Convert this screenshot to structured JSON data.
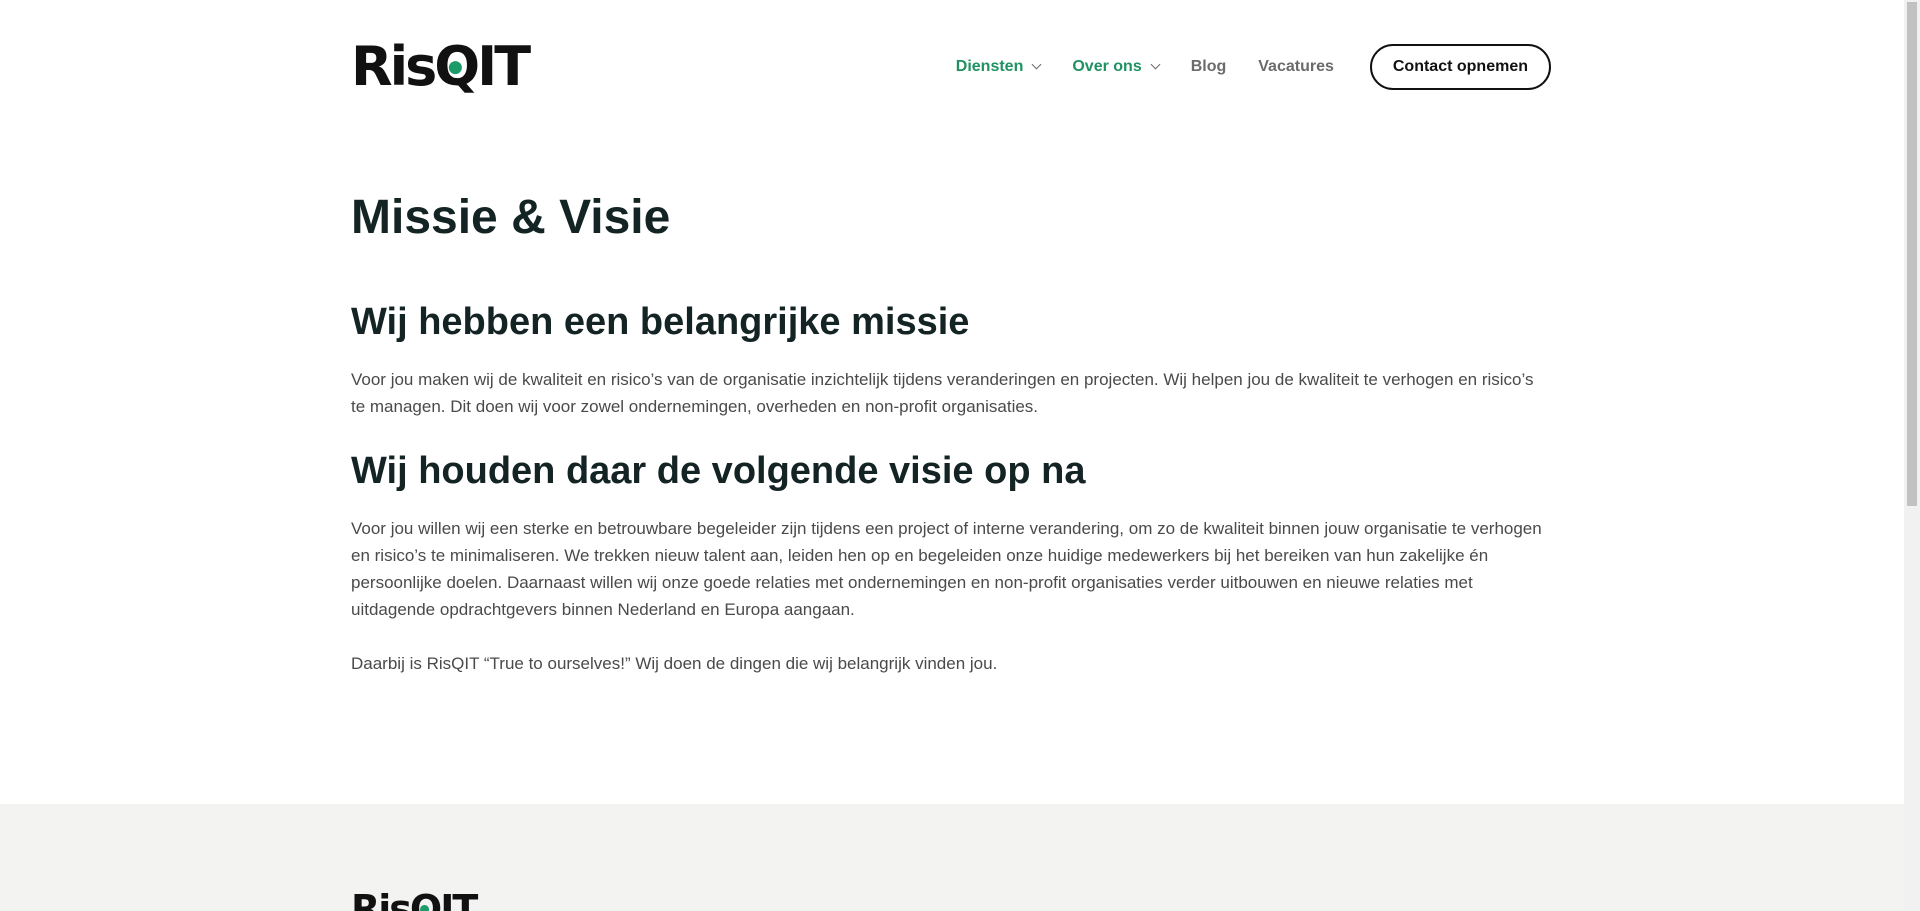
{
  "brand": {
    "logo_prefix": "Ris",
    "logo_q": "Q",
    "logo_suffix": "IT",
    "accent_color": "#1b9a6a"
  },
  "nav": {
    "items": [
      {
        "label": "Diensten",
        "has_dropdown": true
      },
      {
        "label": "Over ons",
        "has_dropdown": true
      },
      {
        "label": "Blog",
        "has_dropdown": false
      },
      {
        "label": "Vacatures",
        "has_dropdown": false
      }
    ],
    "cta_label": "Contact opnemen"
  },
  "main": {
    "title": "Missie & Visie",
    "sections": [
      {
        "heading": "Wij hebben een belangrijke missie",
        "paragraphs": [
          "Voor jou maken wij de kwaliteit en risico’s van de organisatie inzichtelijk tijdens veranderingen en projecten. Wij helpen jou de kwaliteit te verhogen en risico’s te managen. Dit doen wij voor zowel ondernemingen, overheden en non-profit organisaties."
        ]
      },
      {
        "heading": "Wij houden daar de volgende visie op na",
        "paragraphs": [
          "Voor jou willen wij een sterke en betrouwbare begeleider zijn tijdens een project of interne verandering, om zo de kwaliteit binnen jouw organisatie te verhogen en risico’s te minimaliseren. We trekken nieuw talent aan, leiden hen op en begeleiden onze huidige medewerkers bij het bereiken van hun zakelijke én persoonlijke doelen. Daarnaast willen wij onze goede relaties met ondernemingen en non-profit organisaties verder uitbouwen en nieuwe relaties met uitdagende opdrachtgevers binnen Nederland en Europa aangaan.",
          "Daarbij is RisQIT “True to ourselves!” Wij doen de dingen die wij belangrijk vinden jou."
        ]
      }
    ]
  },
  "footer": {
    "logo_prefix": "Ris",
    "logo_q": "Q",
    "logo_suffix": "IT"
  }
}
